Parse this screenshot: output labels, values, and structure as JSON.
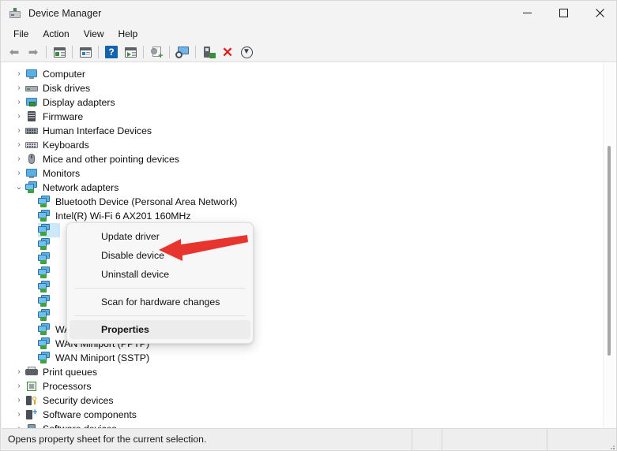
{
  "window": {
    "title": "Device Manager",
    "icon": "device-manager-icon",
    "minimize_label": "—",
    "maximize_label": "□",
    "close_label": "✕"
  },
  "menubar": {
    "items": [
      {
        "label": "File"
      },
      {
        "label": "Action"
      },
      {
        "label": "View"
      },
      {
        "label": "Help"
      }
    ]
  },
  "toolbar": {
    "buttons": [
      {
        "name": "back-icon",
        "glyph": "⬅"
      },
      {
        "name": "forward-icon",
        "glyph": "➡"
      },
      {
        "name": "show-hide-console-tree-icon",
        "glyph": ""
      },
      {
        "name": "properties-icon",
        "glyph": ""
      },
      {
        "name": "help-icon",
        "glyph": "?"
      },
      {
        "name": "show-hide-action-pane-icon",
        "glyph": ""
      },
      {
        "name": "update-driver-icon",
        "glyph": "+"
      },
      {
        "name": "scan-for-hardware-changes-icon",
        "glyph": ""
      },
      {
        "name": "enable-device-icon",
        "glyph": ""
      },
      {
        "name": "uninstall-device-icon",
        "glyph": "✕"
      },
      {
        "name": "disable-device-icon",
        "glyph": "⬇"
      }
    ]
  },
  "tree": {
    "nodes": [
      {
        "label": "Computer",
        "icon": "computer-icon",
        "level": 0,
        "expanded": false,
        "chevron": "›"
      },
      {
        "label": "Disk drives",
        "icon": "disk-drive-icon",
        "level": 0,
        "expanded": false,
        "chevron": "›"
      },
      {
        "label": "Display adapters",
        "icon": "display-adapter-icon",
        "level": 0,
        "expanded": false,
        "chevron": "›"
      },
      {
        "label": "Firmware",
        "icon": "firmware-icon",
        "level": 0,
        "expanded": false,
        "chevron": "›"
      },
      {
        "label": "Human Interface Devices",
        "icon": "hid-icon",
        "level": 0,
        "expanded": false,
        "chevron": "›"
      },
      {
        "label": "Keyboards",
        "icon": "keyboard-icon",
        "level": 0,
        "expanded": false,
        "chevron": "›"
      },
      {
        "label": "Mice and other pointing devices",
        "icon": "mouse-icon",
        "level": 0,
        "expanded": false,
        "chevron": "›"
      },
      {
        "label": "Monitors",
        "icon": "monitor-icon",
        "level": 0,
        "expanded": false,
        "chevron": "›"
      },
      {
        "label": "Network adapters",
        "icon": "network-adapter-icon",
        "level": 0,
        "expanded": true,
        "chevron": "⌄"
      }
    ],
    "network_children": [
      {
        "label": "Bluetooth Device (Personal Area Network)",
        "icon": "network-adapter-icon",
        "selected": false
      },
      {
        "label": "Intel(R) Wi-Fi 6 AX201 160MHz",
        "icon": "network-adapter-icon",
        "selected": false
      },
      {
        "label": "",
        "icon": "network-adapter-icon",
        "selected": true
      },
      {
        "label": "",
        "icon": "network-adapter-icon",
        "selected": false
      },
      {
        "label": "",
        "icon": "network-adapter-icon",
        "selected": false
      },
      {
        "label": "",
        "icon": "network-adapter-icon",
        "selected": false
      },
      {
        "label": "",
        "icon": "network-adapter-icon",
        "selected": false
      },
      {
        "label": "",
        "icon": "network-adapter-icon",
        "selected": false
      },
      {
        "label": "",
        "icon": "network-adapter-icon",
        "selected": false
      },
      {
        "label": "WAN Miniport (PPPOE)",
        "icon": "network-adapter-icon",
        "selected": false
      },
      {
        "label": "WAN Miniport (PPTP)",
        "icon": "network-adapter-icon",
        "selected": false
      },
      {
        "label": "WAN Miniport (SSTP)",
        "icon": "network-adapter-icon",
        "selected": false
      }
    ],
    "bottom_nodes": [
      {
        "label": "Print queues",
        "icon": "print-queue-icon",
        "chevron": "›"
      },
      {
        "label": "Processors",
        "icon": "processor-icon",
        "chevron": "›"
      },
      {
        "label": "Security devices",
        "icon": "security-device-icon",
        "chevron": "›"
      },
      {
        "label": "Software components",
        "icon": "software-component-icon",
        "chevron": "›"
      },
      {
        "label": "Software devices",
        "icon": "software-device-icon",
        "chevron": "›"
      }
    ]
  },
  "context_menu": {
    "items": [
      {
        "label": "Update driver",
        "bold": false,
        "highlighted": false
      },
      {
        "label": "Disable device",
        "bold": false,
        "highlighted": false
      },
      {
        "label": "Uninstall device",
        "bold": false,
        "highlighted": false
      },
      {
        "separator": true
      },
      {
        "label": "Scan for hardware changes",
        "bold": false,
        "highlighted": false
      },
      {
        "separator": true
      },
      {
        "label": "Properties",
        "bold": true,
        "highlighted": true
      }
    ]
  },
  "annotation": {
    "arrow_color": "#e8342e",
    "points_to": "Disable device"
  },
  "statusbar": {
    "message": "Opens property sheet for the current selection."
  },
  "colors": {
    "window_bg": "#f3f3f3",
    "content_bg": "#ffffff",
    "selection": "#cde8f9",
    "menu_bg": "#f7f7f7",
    "accent_red": "#e8342e",
    "icon_blue": "#57b0e6",
    "icon_green": "#3fa13f"
  }
}
